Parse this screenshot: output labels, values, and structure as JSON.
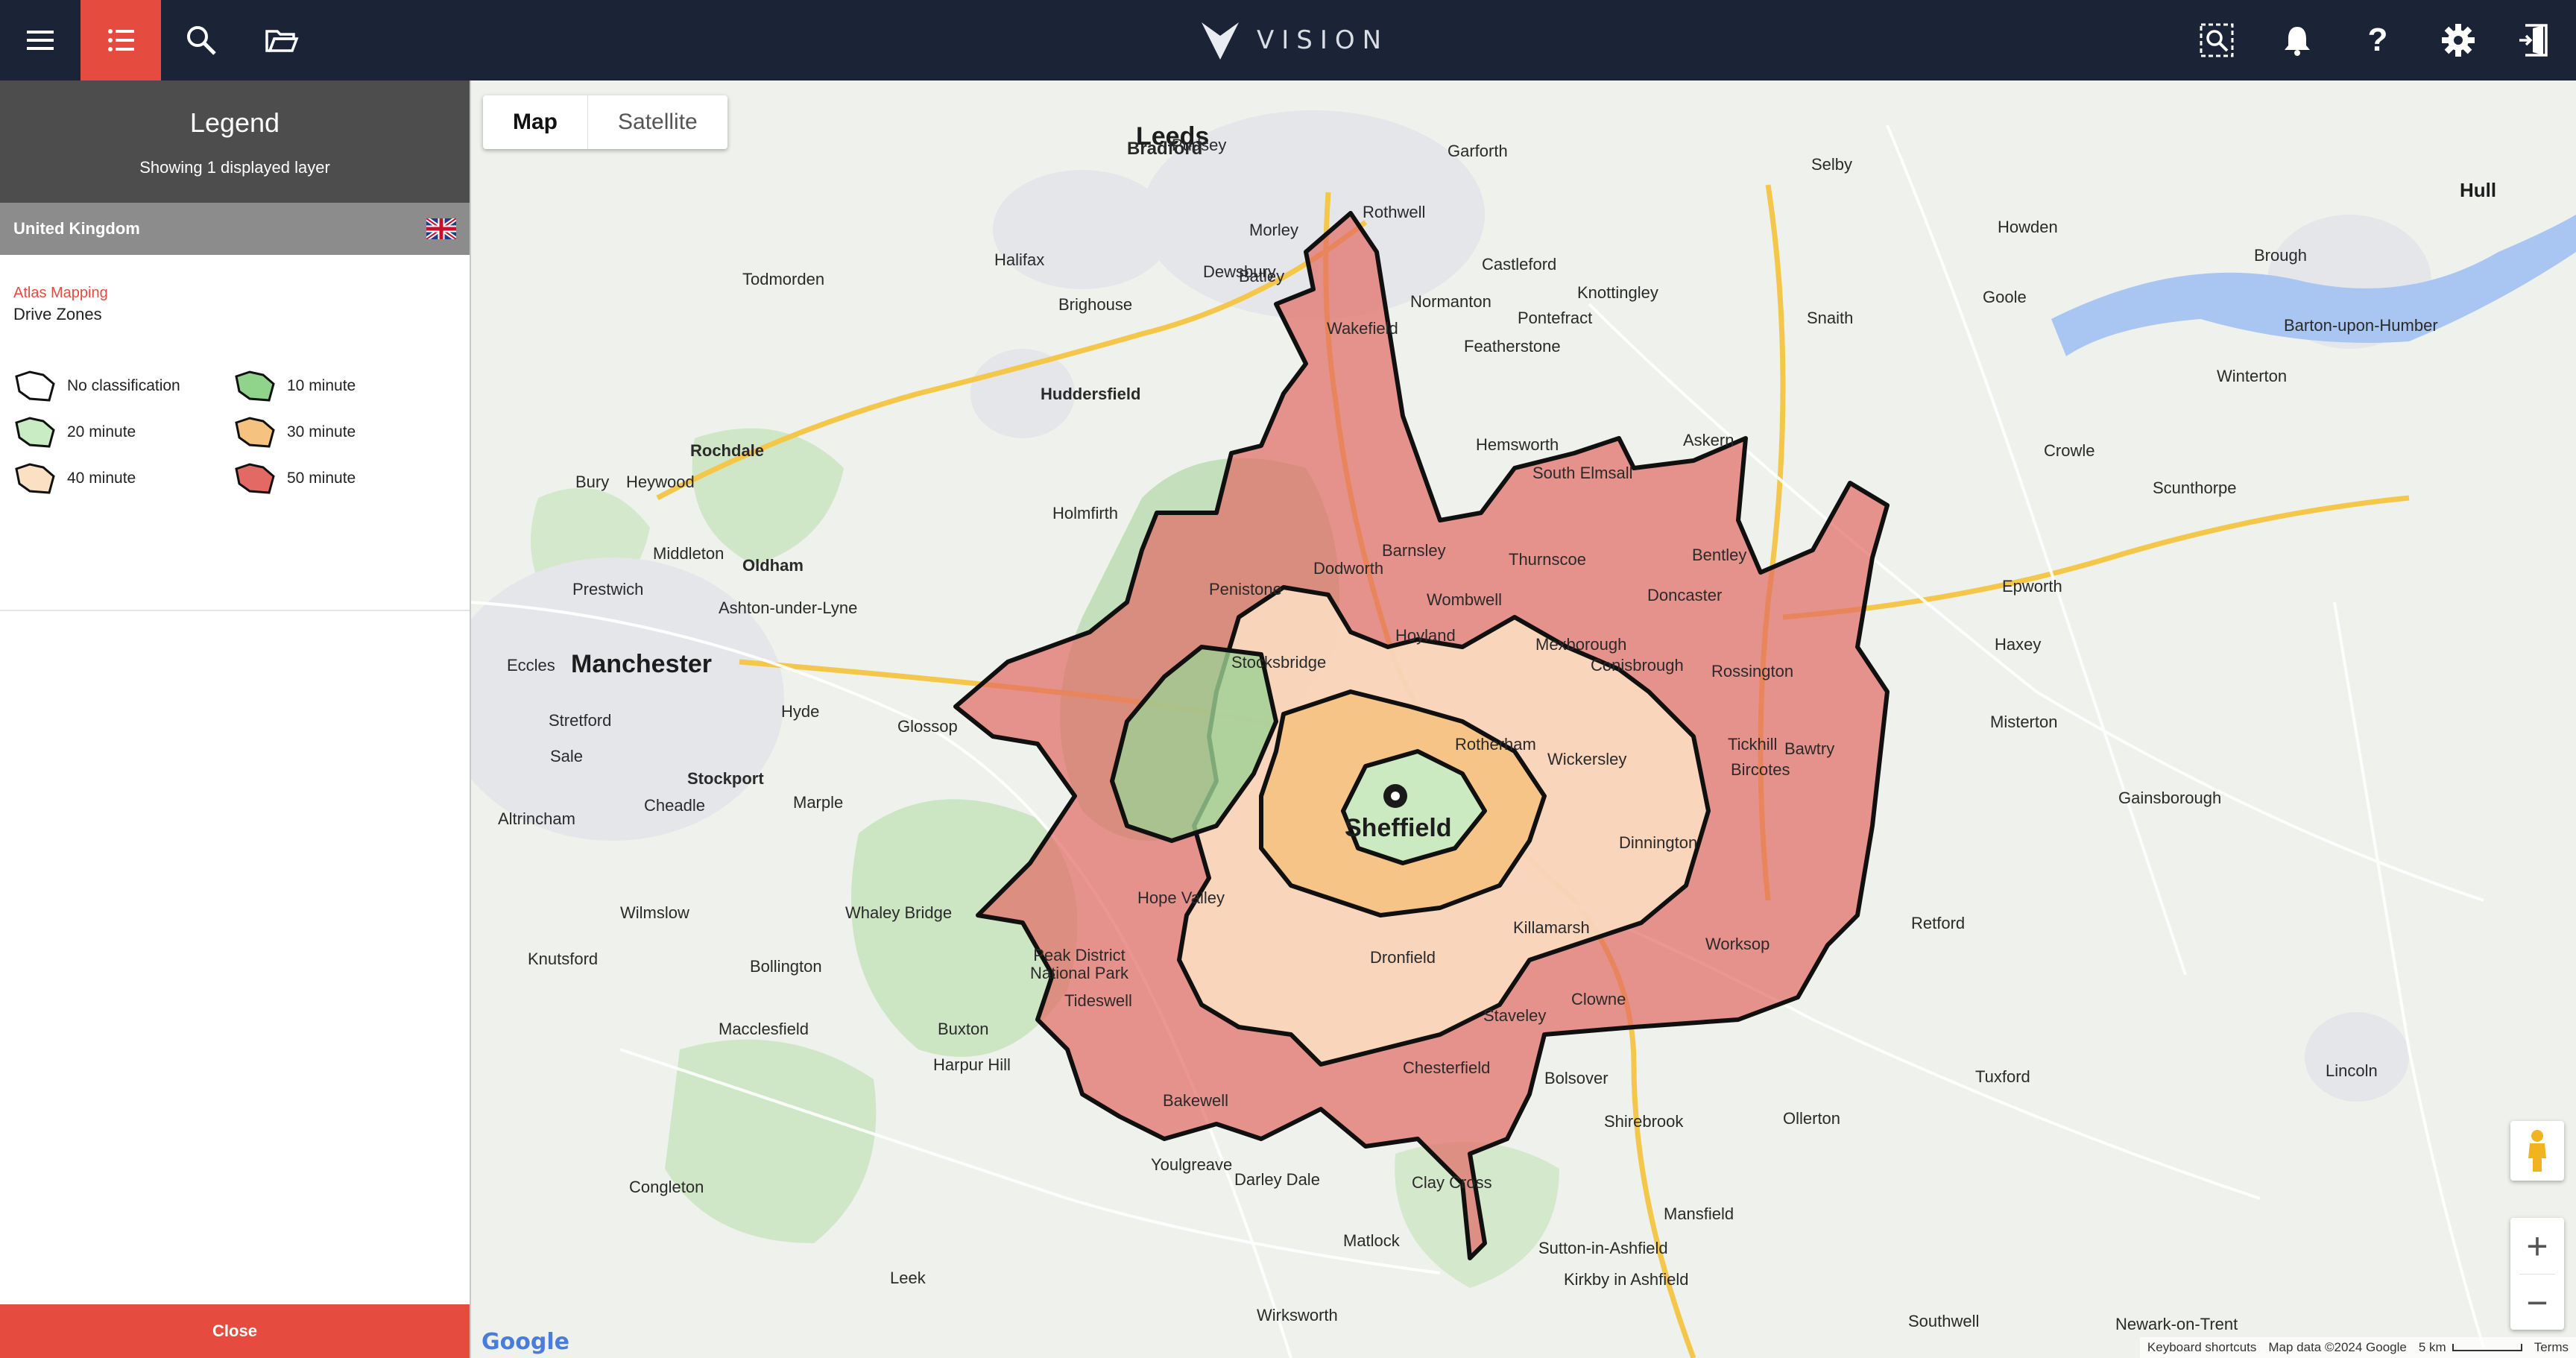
{
  "app": {
    "brand": "VISION"
  },
  "topbar": {
    "left_icons": [
      "menu-icon",
      "list-icon",
      "search-icon",
      "folder-open-icon"
    ],
    "right_icons": [
      "area-search-icon",
      "bell-icon",
      "help-icon",
      "gear-icon",
      "logout-icon"
    ],
    "help_glyph": "?"
  },
  "legend": {
    "title": "Legend",
    "subtitle": "Showing 1 displayed layer",
    "country": "United Kingdom",
    "layer_source": "Atlas Mapping",
    "layer_name": "Drive Zones",
    "items": [
      {
        "label": "No classification",
        "color": "#ffffff"
      },
      {
        "label": "10 minute",
        "color": "#8fd48a"
      },
      {
        "label": "20 minute",
        "color": "#c9ecc4"
      },
      {
        "label": "30 minute",
        "color": "#f5c27f"
      },
      {
        "label": "40 minute",
        "color": "#fbe0c4"
      },
      {
        "label": "50 minute",
        "color": "#e36a64"
      }
    ],
    "close_label": "Close"
  },
  "map": {
    "type_buttons": {
      "map": "Map",
      "satellite": "Satellite"
    },
    "zoom_in": "+",
    "zoom_out": "−",
    "google": "Google",
    "attribution": {
      "shortcuts": "Keyboard shortcuts",
      "data": "Map data ©2024 Google",
      "scale": "5 km",
      "terms": "Terms"
    },
    "labels": {
      "leeds": "Leeds",
      "manchester": "Manchester",
      "sheffield": "Sheffield",
      "hull": "Hull",
      "bradford": "Bradford",
      "huddersfield": "Huddersfield",
      "wakefield": "Wakefield",
      "barnsley": "Barnsley",
      "rotherham": "Rotherham",
      "doncaster": "Doncaster",
      "chesterfield": "Chesterfield",
      "stockport": "Stockport",
      "oldham": "Oldham",
      "rochdale": "Rochdale",
      "mansfield": "Mansfield",
      "worksop": "Worksop",
      "matlock": "Matlock",
      "macclesfield": "Macclesfield",
      "buxton": "Buxton",
      "glossop": "Glossop",
      "hope_valley": "Hope Valley",
      "peak_district": "Peak District National Park",
      "retford": "Retford",
      "gainsborough": "Gainsborough",
      "lincoln": "Lincoln",
      "scunthorpe": "Scunthorpe",
      "goole": "Goole",
      "selby": "Selby",
      "castleford": "Castleford",
      "pontefract": "Pontefract",
      "dewsbury": "Dewsbury",
      "halifax": "Halifax",
      "penistone": "Penistone",
      "mexborough": "Mexborough",
      "dronfield": "Dronfield",
      "bakewell": "Bakewell",
      "bolsover": "Bolsover",
      "staveley": "Staveley",
      "clowne": "Clowne",
      "killamarsh": "Killamarsh",
      "tickhill": "Tickhill",
      "bircotes": "Bircotes",
      "rossington": "Rossington",
      "wombwell": "Wombwell",
      "hoyland": "Hoyland",
      "stocksbridge": "Stocksbridge",
      "thurnscoe": "Thurnscoe",
      "holmfirth": "Holmfirth",
      "marple": "Marple",
      "hyde": "Hyde",
      "cheadle": "Cheadle",
      "wilmslow": "Wilmslow",
      "whaley_bridge": "Whaley Bridge",
      "tideswell": "Tideswell",
      "darley_dale": "Darley Dale",
      "clay_cross": "Clay Cross",
      "shirebrook": "Shirebrook",
      "ollerton": "Ollerton",
      "tuxford": "Tuxford",
      "newark": "Newark-on-Trent",
      "southwell": "Southwell",
      "crowle": "Crowle",
      "epworth": "Epworth",
      "misterton": "Misterton",
      "knottingley": "Knottingley",
      "featherstone": "Featherstone",
      "hemsworth": "Hemsworth",
      "south_elmsall": "South Elmsall",
      "askern": "Askern",
      "bentley": "Bentley",
      "barton": "Barton-upon-Humber",
      "brough": "Brough",
      "howden": "Howden",
      "snaith": "Snaith",
      "winterton": "Winterton",
      "haxey": "Haxey",
      "bawtry": "Bawtry",
      "dinnington": "Dinnington",
      "wickersley": "Wickersley",
      "conisbrough": "Conisbrough",
      "dodworth": "Dodworth",
      "ashton": "Ashton-under-Lyne",
      "eccles": "Eccles",
      "stretford": "Stretford",
      "sale": "Sale",
      "altrincham": "Altrincham",
      "knutsford": "Knutsford",
      "congleton": "Congleton",
      "leek": "Leek",
      "bollington": "Bollington",
      "harpur_hill": "Harpur Hill",
      "youlgreave": "Youlgreave",
      "wirksworth": "Wirksworth",
      "sutton_in_ashfield": "Sutton-in-Ashfield",
      "kirkby": "Kirkby in Ashfield",
      "bury": "Bury",
      "heywood": "Heywood",
      "middleton": "Middleton",
      "prestwich": "Prestwich",
      "todmorden": "Todmorden",
      "brighouse": "Brighouse",
      "batley": "Batley",
      "morley": "Morley",
      "pudsey": "Pudsey",
      "garforth": "Garforth",
      "rothwell": "Rothwell",
      "normanton": "Normanton"
    }
  }
}
